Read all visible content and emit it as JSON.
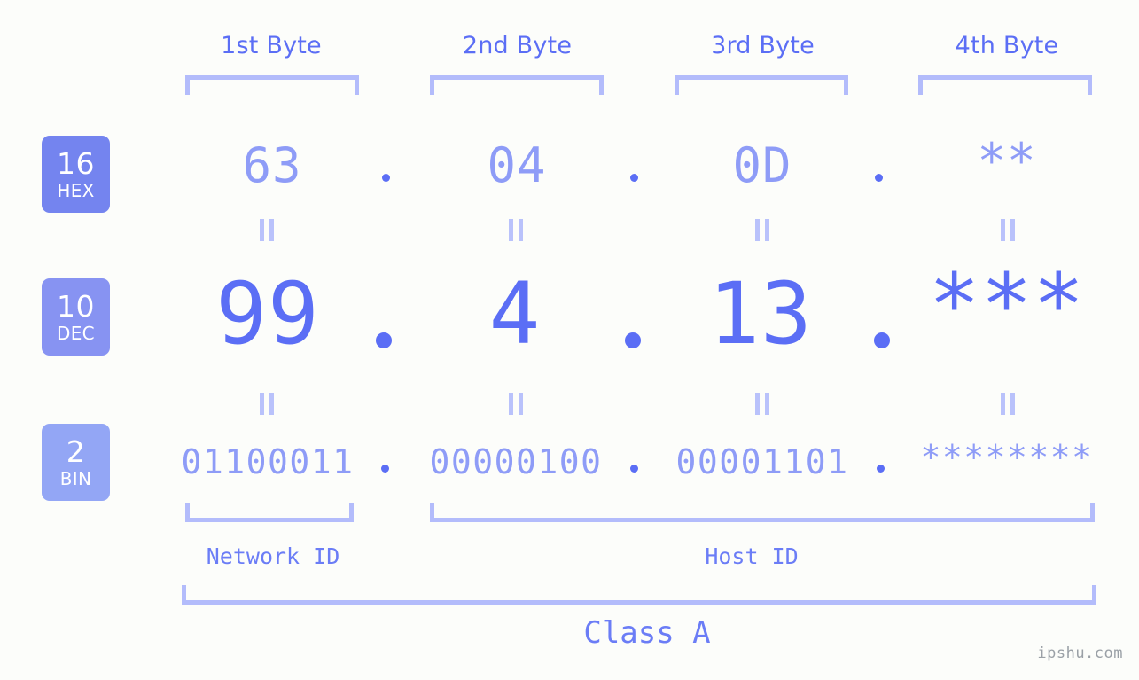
{
  "watermark": "ipshu.com",
  "byte_headers": [
    {
      "label": "1st Byte"
    },
    {
      "label": "2nd Byte"
    },
    {
      "label": "3rd Byte"
    },
    {
      "label": "4th Byte"
    }
  ],
  "rows": [
    {
      "badge_number": "16",
      "badge_word": "HEX",
      "badge_color": "#7484ef",
      "values": [
        "63",
        "04",
        "0D",
        "**"
      ]
    },
    {
      "badge_number": "10",
      "badge_word": "DEC",
      "badge_color": "#8793f2",
      "values": [
        "99",
        "4",
        "13",
        "***"
      ]
    },
    {
      "badge_number": "2",
      "badge_word": "BIN",
      "badge_color": "#93a6f5",
      "values": [
        "01100011",
        "00000100",
        "00001101",
        "********"
      ]
    }
  ],
  "separator": ".",
  "equals_mark": "=",
  "sections": {
    "network_id": "Network ID",
    "host_id": "Host ID",
    "class": "Class A"
  },
  "colors": {
    "background": "#fcfdfa",
    "accent": "#5b6ef5",
    "accent_light": "#8e9cf7",
    "bracket": "#b3bcfb",
    "badge_text": "#ffffff",
    "watermark": "#9aa0a6"
  }
}
